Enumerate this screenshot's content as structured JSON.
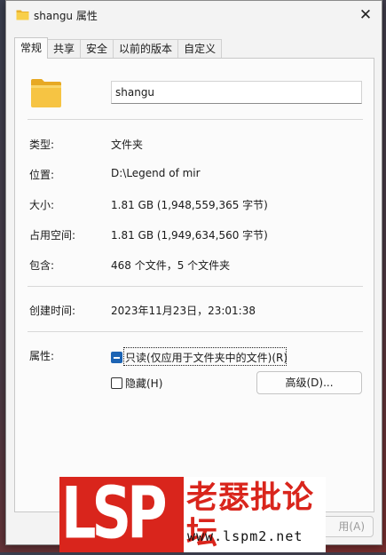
{
  "window": {
    "title": "shangu 属性",
    "close_label": "✕"
  },
  "tabs": [
    {
      "label": "常规",
      "active": true
    },
    {
      "label": "共享",
      "active": false
    },
    {
      "label": "安全",
      "active": false
    },
    {
      "label": "以前的版本",
      "active": false
    },
    {
      "label": "自定义",
      "active": false
    }
  ],
  "general": {
    "name_value": "shangu",
    "properties": [
      {
        "label": "类型:",
        "value": "文件夹"
      },
      {
        "label": "位置:",
        "value": "D:\\Legend of mir"
      },
      {
        "label": "大小:",
        "value": "1.81 GB (1,948,559,365 字节)"
      },
      {
        "label": "占用空间:",
        "value": "1.81 GB (1,949,634,560 字节)"
      },
      {
        "label": "包含:",
        "value": "468 个文件，5 个文件夹"
      }
    ],
    "created": {
      "label": "创建时间:",
      "value": "2023年11月23日，23:01:38"
    },
    "attributes": {
      "label": "属性:",
      "readonly": {
        "label": "只读(仅应用于文件夹中的文件)(R)",
        "state": "indeterminate"
      },
      "hidden": {
        "label": "隐藏(H)",
        "checked": false
      },
      "advanced_label": "高级(D)..."
    }
  },
  "footer": {
    "apply_label": "用(A)"
  },
  "watermark": {
    "logo_text": "LSP",
    "cn_text": "老瑟批论坛",
    "url": "www.lspm2.net"
  },
  "colors": {
    "accent": "#1d64b4",
    "watermark_red": "#d9251c",
    "folder_yellow": "#f3c13a"
  }
}
